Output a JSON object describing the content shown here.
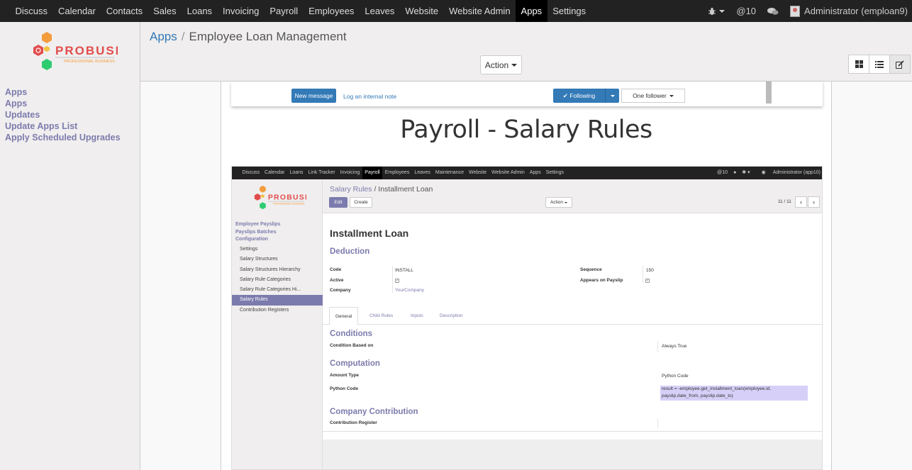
{
  "topbar": {
    "menu": [
      "Discuss",
      "Calendar",
      "Contacts",
      "Sales",
      "Loans",
      "Invoicing",
      "Payroll",
      "Employees",
      "Leaves",
      "Website",
      "Website Admin",
      "Apps",
      "Settings"
    ],
    "active": "Apps",
    "mentions": "@10",
    "user": "Administrator (emploan9)"
  },
  "logo": {
    "brand": "PROBUSE",
    "tagline": "PROFESSIONAL BUSINESS"
  },
  "sidebar": {
    "items": [
      "Apps",
      "Apps",
      "Updates",
      "Update Apps List",
      "Apply Scheduled Upgrades"
    ]
  },
  "control_panel": {
    "breadcrumb_root": "Apps",
    "breadcrumb_separator": "/",
    "breadcrumb_current": "Employee Loan Management",
    "action_label": "Action"
  },
  "chatter": {
    "new_message": "New message",
    "log_note": "Log an internal note",
    "following": "Following",
    "followers": "One follower"
  },
  "section_title": "Payroll - Salary Rules",
  "shot": {
    "menu": [
      "Discuss",
      "Calendar",
      "Loans",
      "Link Tracker",
      "Invoicing",
      "Payroll",
      "Employees",
      "Leaves",
      "Maintenance",
      "Website",
      "Website Admin",
      "Apps",
      "Settings"
    ],
    "active": "Payroll",
    "mentions": "@10",
    "user": "Administrator (app10)",
    "sidebar_sections": [
      "Employee Payslips",
      "Payslips Batches",
      "Configuration"
    ],
    "sidebar_items": [
      "Settings",
      "Salary Structures",
      "Salary Structures Hierarchy",
      "Salary Rule Categories",
      "Salary Rule Categories Hi...",
      "Salary Rules",
      "Contribution Registers"
    ],
    "sidebar_selected": "Salary Rules",
    "breadcrumb_root": "Salary Rules",
    "breadcrumb_separator": "/",
    "breadcrumb_current": "Installment Loan",
    "edit": "Edit",
    "create": "Create",
    "action": "Action",
    "pager": "11 / 11",
    "form": {
      "name": "Installment Loan",
      "category": "Deduction",
      "code_label": "Code",
      "code_value": "INSTALL",
      "active_label": "Active",
      "company_label": "Company",
      "company_value": "YourCompany",
      "sequence_label": "Sequence",
      "sequence_value": "150",
      "appears_label": "Appears on Payslip",
      "tabs": [
        "General",
        "Child Rules",
        "Inputs",
        "Description"
      ],
      "conditions_title": "Conditions",
      "condition_label": "Condition Based on",
      "condition_value": "Always True",
      "computation_title": "Computation",
      "amount_type_label": "Amount Type",
      "amount_type_value": "Python Code",
      "python_code_label": "Python Code",
      "python_code_line1": "result = -employee.get_installment_loan(employee.id,",
      "python_code_line2": "payslip.date_from, payslip.date_to)",
      "contribution_title": "Company Contribution",
      "register_label": "Contribution Register"
    }
  }
}
